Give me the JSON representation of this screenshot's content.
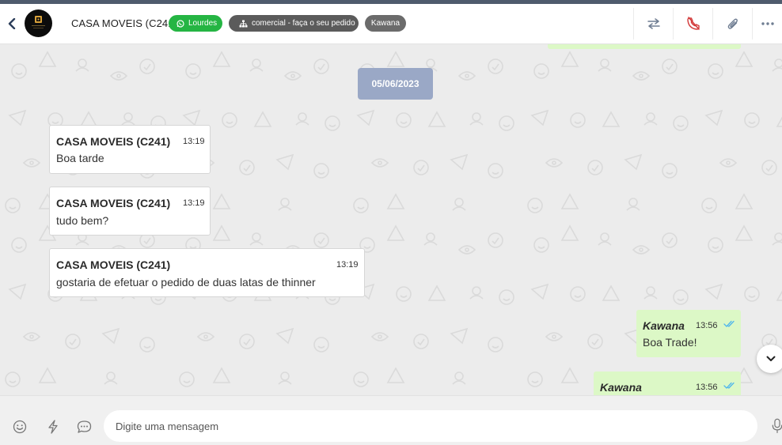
{
  "header": {
    "contact_name": "CASA MOVEIS (C241)",
    "tags": {
      "whatsapp": "Lourdes",
      "queue": "comercial - faça o seu pedido",
      "user": "Kawana"
    },
    "icons": {
      "back": "chevron-left-icon",
      "whatsapp": "whatsapp-icon",
      "queue": "sitemap-icon",
      "transfer": "arrows-transfer-icon",
      "call": "phone-slash-icon",
      "attach": "paperclip-icon",
      "more": "ellipsis-icon"
    },
    "colors": {
      "whatsapp_tag": "#25b543",
      "queue_tag": "#5b5b5b",
      "user_tag": "#6b6b6b",
      "call_icon": "#d33a3a"
    }
  },
  "chat": {
    "date_separator": "05/06/2023",
    "messages": [
      {
        "direction": "in",
        "sender": "CASA MOVEIS (C241)",
        "time": "13:19",
        "text": "Boa tarde"
      },
      {
        "direction": "in",
        "sender": "CASA MOVEIS (C241)",
        "time": "13:19",
        "text": "tudo bem?"
      },
      {
        "direction": "in",
        "sender": "CASA MOVEIS (C241)",
        "time": "13:19",
        "text": "gostaria de efetuar o pedido de duas latas de thinner"
      },
      {
        "direction": "out",
        "sender": "Kawana",
        "time": "13:56",
        "text": "Boa Trade!",
        "status": "read"
      },
      {
        "direction": "out",
        "sender": "Kawana",
        "time": "13:56",
        "text": "",
        "status": "read"
      }
    ],
    "colors": {
      "incoming": "#ffffff",
      "outgoing": "#dcf8c6",
      "date_pill": "#9aa8c6",
      "read_ticks": "#4fb6ec"
    }
  },
  "composer": {
    "placeholder": "Digite uma mensagem",
    "icons": {
      "emoji": "smile-icon",
      "quick_reply": "bolt-icon",
      "chat": "chat-bubble-icon",
      "mic": "microphone-icon",
      "scroll": "chevron-down-icon"
    }
  }
}
